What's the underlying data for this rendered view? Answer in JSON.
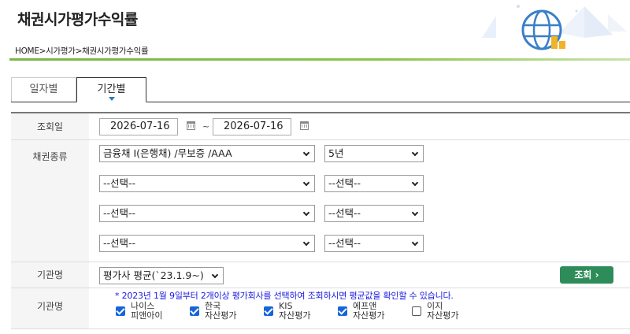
{
  "page": {
    "title": "채권시가평가수익률",
    "breadcrumb": "HOME>시가평가>채권시가평가수익률"
  },
  "tabs": [
    {
      "label": "일자별",
      "active": false
    },
    {
      "label": "기간별",
      "active": true
    }
  ],
  "form": {
    "date_label": "조회일",
    "start_date": "2026-07-16",
    "end_date": "2026-07-16",
    "separator": "~",
    "bond_label": "채권종류",
    "bond_rows": [
      {
        "type": "금융채 I(은행채) /무보증 /AAA",
        "term": "5년"
      },
      {
        "type": "--선택--",
        "term": "--선택--"
      },
      {
        "type": "--선택--",
        "term": "--선택--"
      },
      {
        "type": "--선택--",
        "term": "--선택--"
      }
    ],
    "org_label": "기관명",
    "org_select": "평가사 평균(`23.1.9~)",
    "search_button": "조회 ›",
    "org2_label": "기관명",
    "notice": "* 2023년 1월 9일부터 2개이상 평가회사를 선택하여 조회하시면 평균값을 확인할 수 있습니다.",
    "checkboxes": [
      {
        "line1": "나이스",
        "line2": "피앤아이",
        "checked": true
      },
      {
        "line1": "한국",
        "line2": "자산평가",
        "checked": true
      },
      {
        "line1": "KIS",
        "line2": "자산평가",
        "checked": true
      },
      {
        "line1": "에프앤",
        "line2": "자산평가",
        "checked": true
      },
      {
        "line1": "이지",
        "line2": "자산평가",
        "checked": false
      }
    ]
  },
  "colors": {
    "accent_green": "#2e8c5a",
    "checkbox_blue": "#1565d8",
    "notice_blue": "#1a1ae0",
    "header_line": "#7ab54a"
  }
}
